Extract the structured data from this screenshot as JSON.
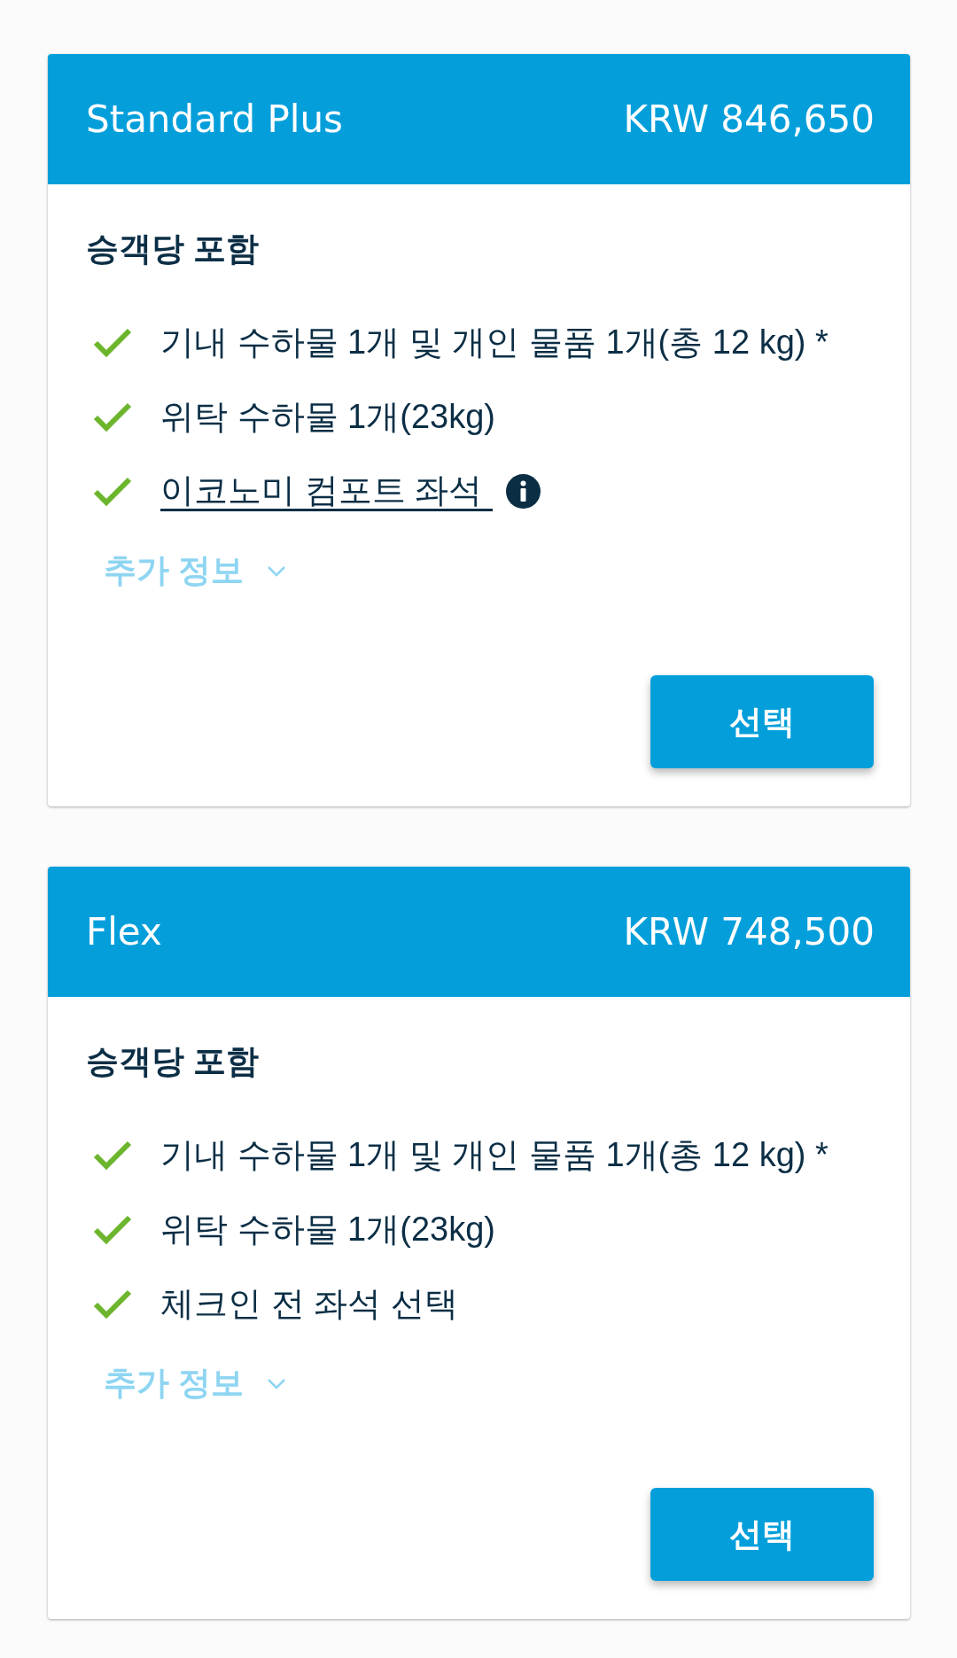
{
  "fares": [
    {
      "name": "Standard Plus",
      "price": "KRW 846,650",
      "included_heading": "승객당 포함",
      "features": [
        {
          "kind": "text",
          "text": "기내 수하물 1개 및 개인 물품 1개(총 12 kg) *",
          "included": true,
          "info": false
        },
        {
          "kind": "text",
          "text": "위탁 수하물 1개(23kg)",
          "included": true,
          "info": false
        },
        {
          "kind": "link",
          "text": "이코노미 컴포트 좌석",
          "included": true,
          "info": true
        }
      ],
      "more_info": {
        "label": "추가 정보",
        "expanded": false
      },
      "select_button": "선택"
    },
    {
      "name": "Flex",
      "price": "KRW 748,500",
      "included_heading": "승객당 포함",
      "features": [
        {
          "kind": "text",
          "text": "기내 수하물 1개 및 개인 물품 1개(총 12 kg) *",
          "included": true,
          "info": false
        },
        {
          "kind": "text",
          "text": "위탁 수하물 1개(23kg)",
          "included": true,
          "info": false
        },
        {
          "kind": "text",
          "text": "체크인 전 좌석 선택",
          "included": true,
          "info": false
        }
      ],
      "more_info": {
        "label": "추가 정보",
        "expanded": false
      },
      "select_button": "선택"
    }
  ]
}
